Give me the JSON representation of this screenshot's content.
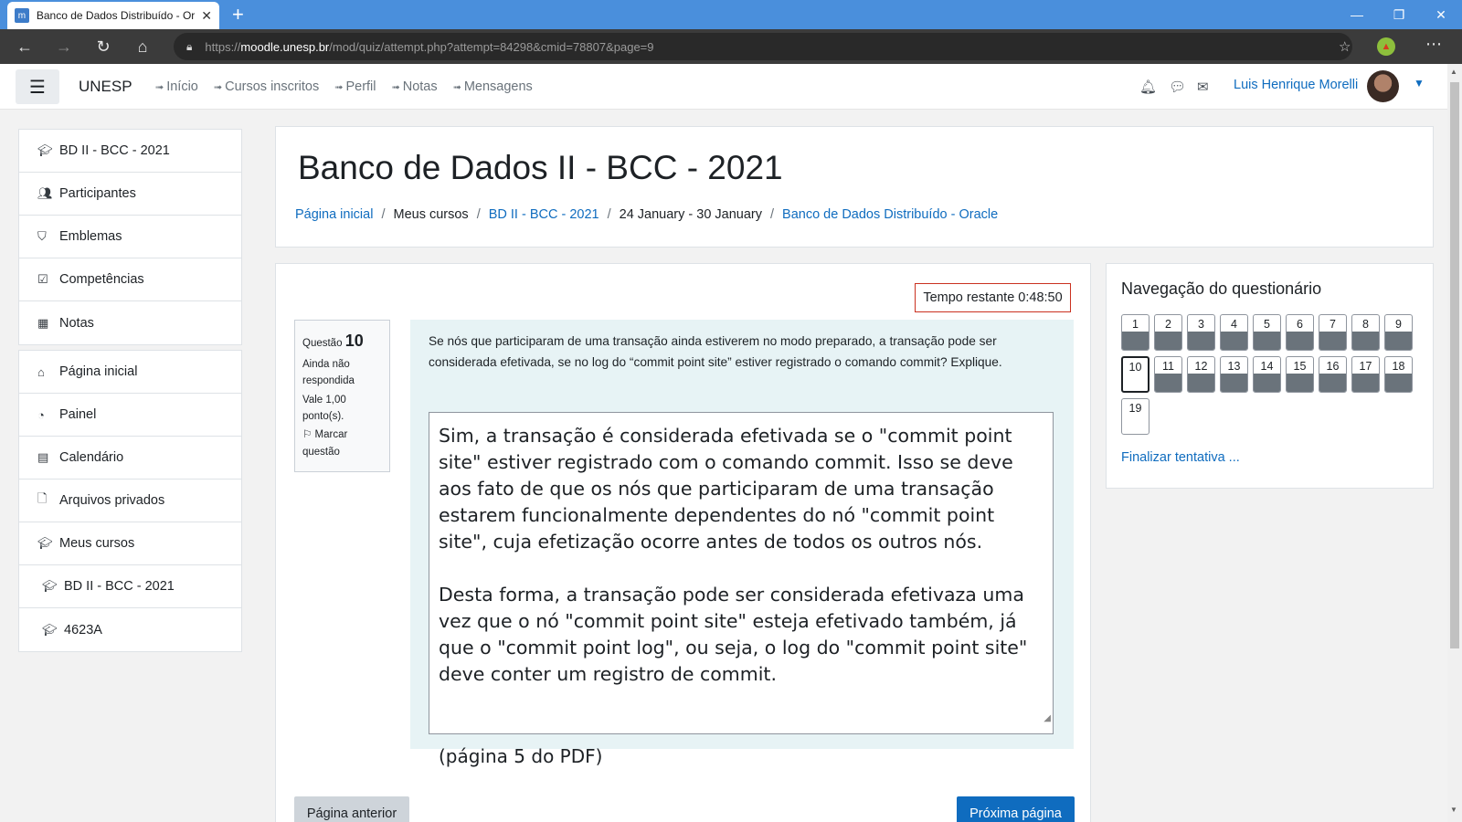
{
  "browser": {
    "tab_title": "Banco de Dados Distribuído - Or",
    "url_prefix": "https://",
    "url_host": "moodle.unesp.br",
    "url_path": "/mod/quiz/attempt.php?attempt=84298&cmid=78807&page=9"
  },
  "navbar": {
    "brand": "UNESP",
    "links": [
      "Início",
      "Cursos inscritos",
      "Perfil",
      "Notas",
      "Mensagens"
    ],
    "user_name": "Luis Henrique Morelli"
  },
  "sidebar": {
    "group1": [
      {
        "label": "BD II - BCC - 2021",
        "icon": "graduation-cap-icon"
      },
      {
        "label": "Participantes",
        "icon": "users-icon"
      },
      {
        "label": "Emblemas",
        "icon": "shield-icon"
      },
      {
        "label": "Competências",
        "icon": "check-square-icon"
      },
      {
        "label": "Notas",
        "icon": "table-icon"
      }
    ],
    "group2": [
      {
        "label": "Página inicial",
        "icon": "home-icon"
      },
      {
        "label": "Painel",
        "icon": "dashboard-icon"
      },
      {
        "label": "Calendário",
        "icon": "calendar-icon"
      },
      {
        "label": "Arquivos privados",
        "icon": "file-icon"
      },
      {
        "label": "Meus cursos",
        "icon": "graduation-cap-icon"
      },
      {
        "label": "BD II - BCC - 2021",
        "icon": "graduation-cap-icon"
      },
      {
        "label": "4623A",
        "icon": "graduation-cap-icon"
      }
    ]
  },
  "header": {
    "title": "Banco de Dados II - BCC - 2021",
    "breadcrumb": [
      "Página inicial",
      "Meus cursos",
      "BD II - BCC - 2021",
      "24 January - 30 January",
      "Banco de Dados Distribuído - Oracle"
    ]
  },
  "quiz": {
    "timer": "Tempo restante 0:48:50",
    "question_label": "Questão",
    "question_number": "10",
    "status": "Ainda não respondida",
    "grade": "Vale 1,00 ponto(s).",
    "flag": "Marcar questão",
    "question_text": "Se nós que participaram de uma transação ainda estiverem no modo preparado, a transação pode ser considerada efetivada, se no log do “commit point site” estiver registrado o comando commit? Explique.",
    "answer_p1": "Sim, a transação é considerada efetivada se o \"commit point site\" estiver registrado com o comando commit. Isso se deve aos fato de que os nós que participaram de uma transação estarem funcionalmente dependentes do nó \"commit point site\", cuja efetização ocorre antes de todos os outros nós.",
    "answer_p2": "Desta forma, a transação pode ser considerada efetivaza uma vez que o nó \"commit point site\" esteja efetivado também, já que o \"commit point log\", ou seja, o log do \"commit point site\" deve conter um registro de commit.",
    "pdf_note": "(página 5 do PDF)",
    "prev_button": "Página anterior",
    "next_button": "Próxima página"
  },
  "quiz_nav": {
    "title": "Navegação do questionário",
    "buttons": [
      "1",
      "2",
      "3",
      "4",
      "5",
      "6",
      "7",
      "8",
      "9",
      "10",
      "11",
      "12",
      "13",
      "14",
      "15",
      "16",
      "17",
      "18",
      "19"
    ],
    "current": "10",
    "finish": "Finalizar tentativa ..."
  }
}
